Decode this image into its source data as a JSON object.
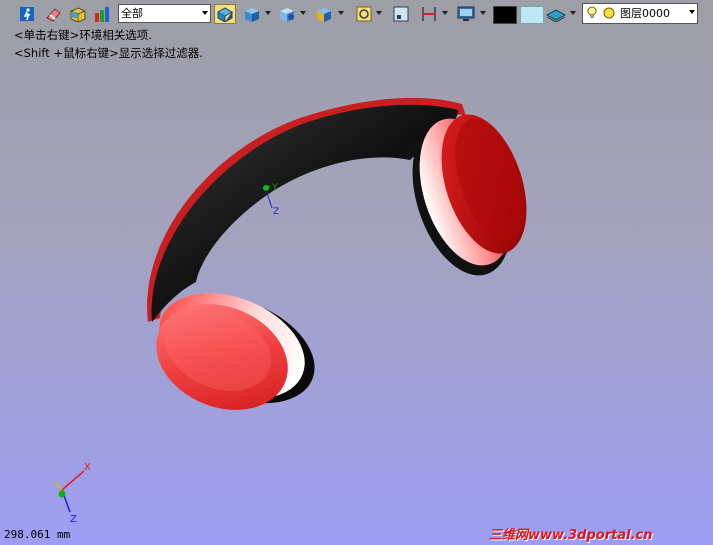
{
  "toolbar": {
    "filter_value": "全部",
    "layer_value": "图层0000",
    "icons": [
      "run-icon",
      "eraser-icon",
      "box-icon",
      "bar-chart-icon",
      "select-filter-icon",
      "cube-icon",
      "cube-view-icon",
      "cube-shade-icon",
      "zoom-fit-icon",
      "window-icon",
      "section-icon",
      "display-icon",
      "black-color-swatch",
      "light-color-swatch",
      "layer-plane-icon",
      "bulb-icon",
      "layer-status-icon"
    ]
  },
  "hints": {
    "line1": "<单击右键>环境相关选项.",
    "line2": "<Shift +鼠标右键>显示选择过滤器."
  },
  "triad": {
    "center_y": "Y",
    "center_z": "Z",
    "corner_x": "X",
    "corner_z": "Z"
  },
  "status": {
    "scale": "298.061 mm"
  },
  "watermark": "三维网www.3dportal.cn",
  "colors": {
    "viewport_top": "#9e9ea6",
    "viewport_bottom": "#9d9df4",
    "headphone_red": "#e8282c",
    "headband_black": "#111111"
  }
}
